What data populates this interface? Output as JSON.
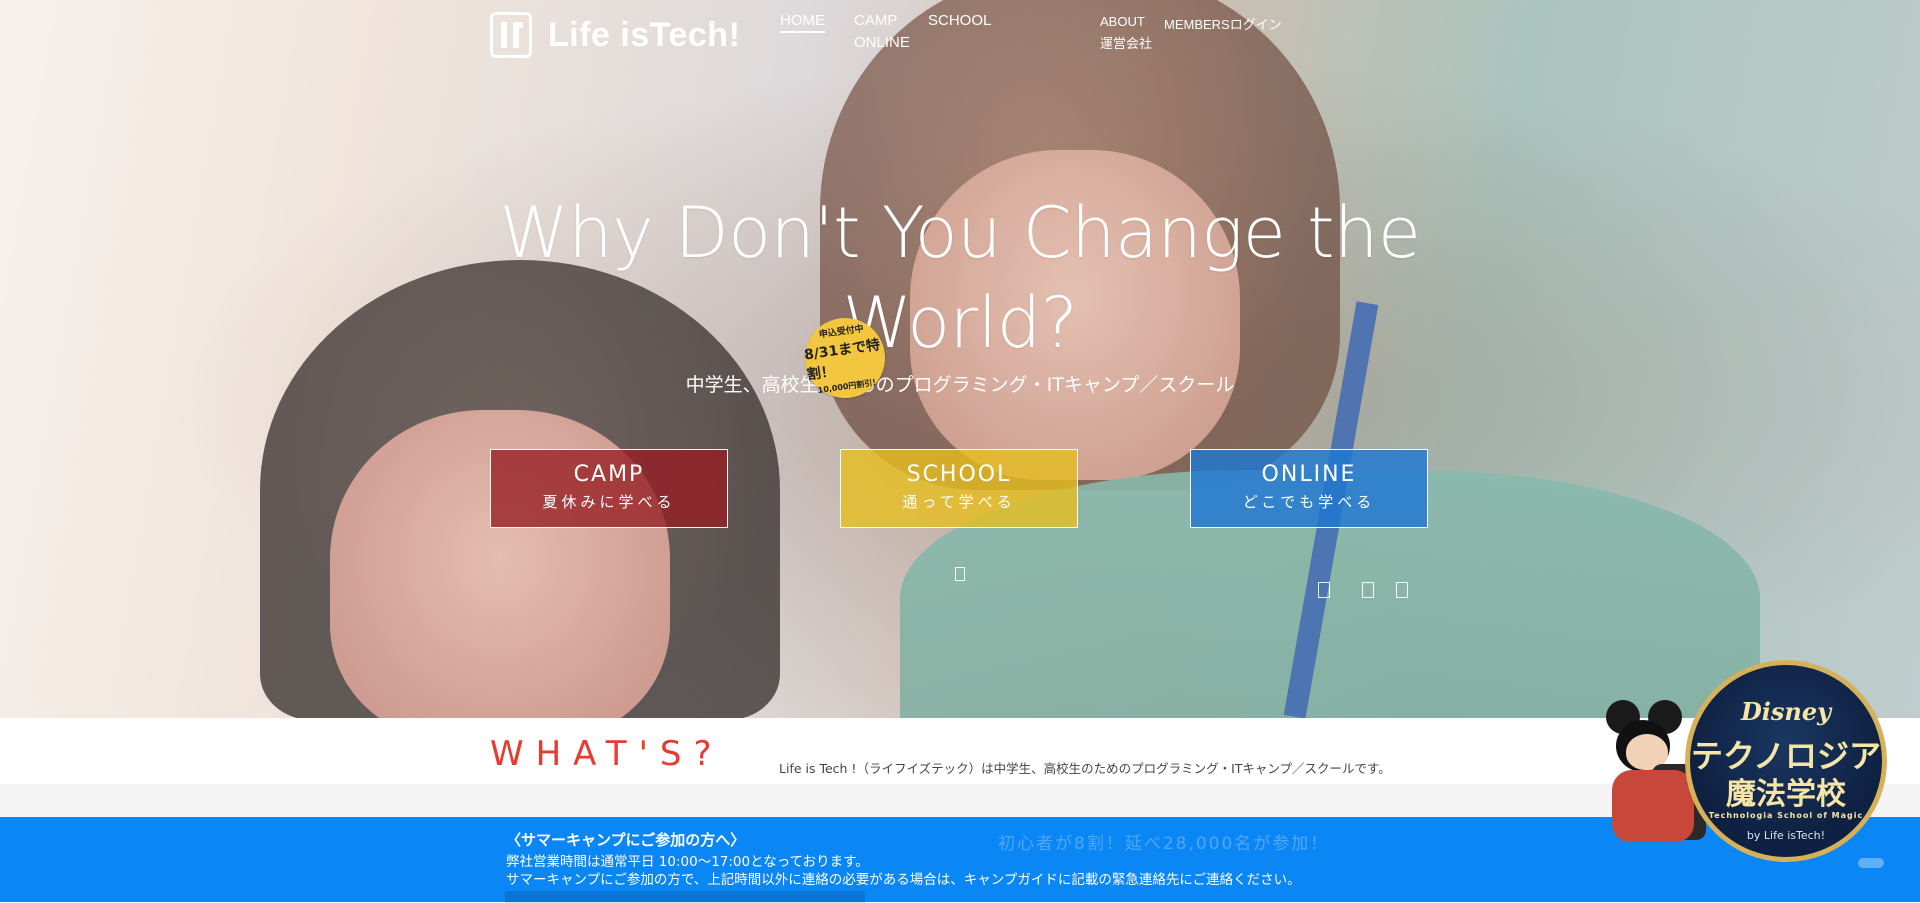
{
  "header": {
    "logo_text": "Life isTech!",
    "nav_main": [
      "HOME",
      "CAMP",
      "SCHOOL",
      "ONLINE"
    ],
    "nav_sub": [
      "ABOUT",
      "MEMBERSログイン",
      "運営会社"
    ]
  },
  "hero": {
    "headline": "Why Don't You Change the World?",
    "subline": "中学生、高校生のためのプログラミング・ITキャンプ／スクール",
    "badge": {
      "line1": "申込受付中",
      "line2": "8/31まで特割！",
      "line3": "10,000円割引！"
    },
    "buttons": [
      {
        "title": "CAMP",
        "subtitle": "夏休みに学べる"
      },
      {
        "title": "SCHOOL",
        "subtitle": "通って学べる"
      },
      {
        "title": "ONLINE",
        "subtitle": "どこでも学べる"
      }
    ]
  },
  "whats": {
    "title": "WHAT'S?",
    "description": "Life is Tech !（ライフイズテック）は中学生、高校生のためのプログラミング・ITキャンプ／スクールです。"
  },
  "notice": {
    "heading": "〈サマーキャンプにご参加の方へ〉",
    "line1": "弊社営業時間は通常平日 10:00〜17:00となっております。",
    "line2": "サマーキャンプにご参加の方で、上記時間以外に連絡の必要がある場合は、キャンプガイドに記載の緊急連絡先にご連絡ください。",
    "background_heading": "初心者が8割！延べ28,000名が参加！"
  },
  "promo": {
    "brand": "Disney",
    "title_line1": "テクノロジア",
    "title_line2": "魔法学校",
    "subtitle": "Technologia School of Magic",
    "by": "by Life isTech!"
  },
  "colors": {
    "camp": "#961e23",
    "school": "#e6be1e",
    "online": "#1e78d2",
    "whats_title": "#e63b2e",
    "notice_bg": "#0b86f5"
  }
}
